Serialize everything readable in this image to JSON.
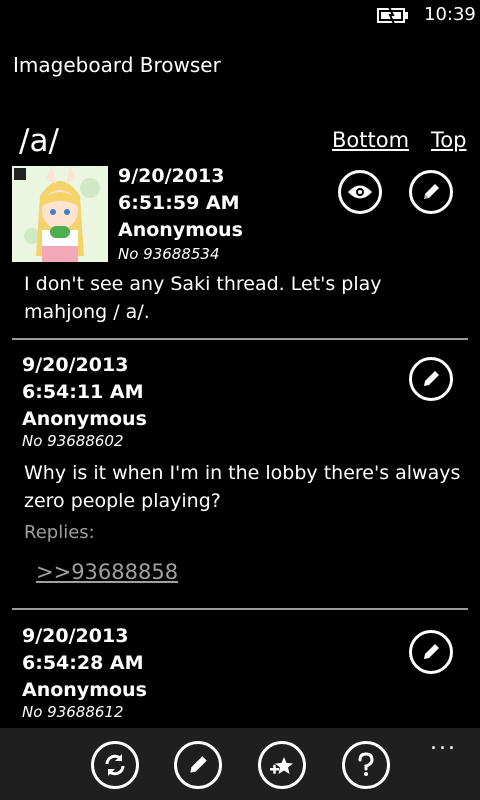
{
  "status": {
    "time": "10:39"
  },
  "app": {
    "title": "Imageboard Browser"
  },
  "board": {
    "name": "/a/",
    "link_bottom": "Bottom",
    "link_top": "Top"
  },
  "posts": [
    {
      "date": "9/20/2013",
      "time": "6:51:59 AM",
      "author": "Anonymous",
      "number": "No 93688534",
      "text": "I don't see any Saki thread. Let's play mahjong / a/."
    },
    {
      "date": "9/20/2013",
      "time": "6:54:11 AM",
      "author": "Anonymous",
      "number": "No 93688602",
      "text": "Why is it when I'm in the lobby there's always zero people playing?",
      "replies_label": "Replies:",
      "replies": [
        ">>93688858"
      ]
    },
    {
      "date": "9/20/2013",
      "time": "6:54:28 AM",
      "author": "Anonymous",
      "number": "No 93688612"
    }
  ],
  "appbar": {
    "buttons": [
      "refresh-icon",
      "compose-icon",
      "add-favorite-icon",
      "help-icon"
    ],
    "more": "..."
  }
}
